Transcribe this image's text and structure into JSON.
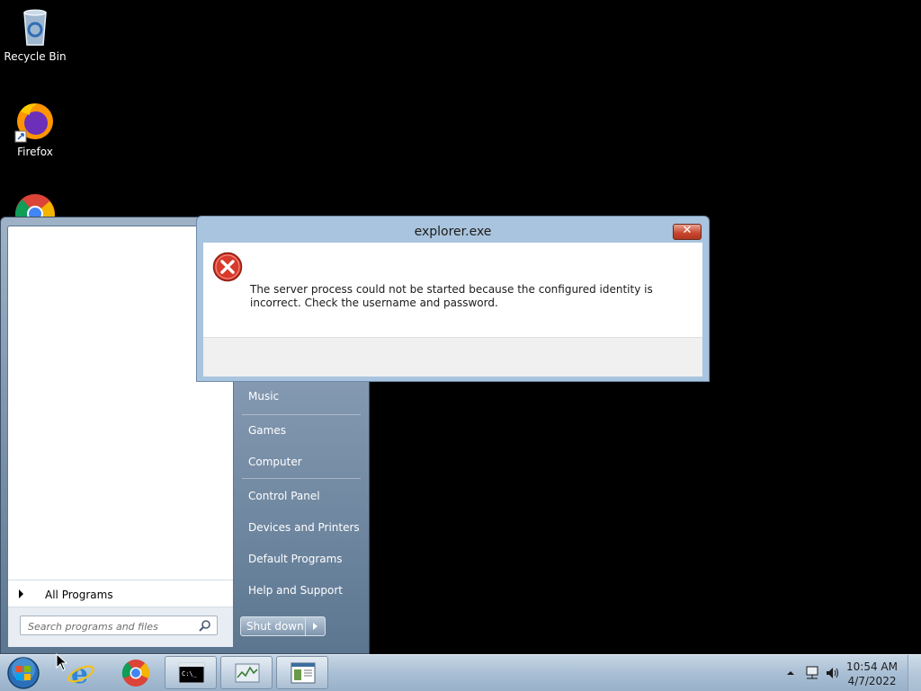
{
  "desktop": {
    "icons": [
      {
        "label": "Recycle Bin",
        "icon": "recycle-bin-icon"
      },
      {
        "label": "Firefox",
        "icon": "firefox-icon"
      },
      {
        "label": "",
        "icon": "chrome-icon"
      }
    ]
  },
  "start_menu": {
    "all_programs": "All Programs",
    "search_placeholder": "Search programs and files",
    "right_items": [
      "Music",
      "Games",
      "Computer",
      "Control Panel",
      "Devices and Printers",
      "Default Programs",
      "Help and Support"
    ],
    "shutdown_label": "Shut down"
  },
  "dialog": {
    "title": "explorer.exe",
    "message": "The server process could not be started because the configured identity is incorrect. Check the username and password.",
    "close_symbol": "✕"
  },
  "taskbar": {
    "pinned": [
      "internet-explorer-icon",
      "chrome-icon",
      "command-prompt-icon",
      "task-manager-icon",
      "window-app-icon"
    ],
    "clock_time": "10:54 AM",
    "clock_date": "4/7/2022"
  },
  "colors": {
    "accent": "#1c5fa8",
    "error_red": "#c0392b",
    "start_menu_bg": "#8aa0b8"
  }
}
